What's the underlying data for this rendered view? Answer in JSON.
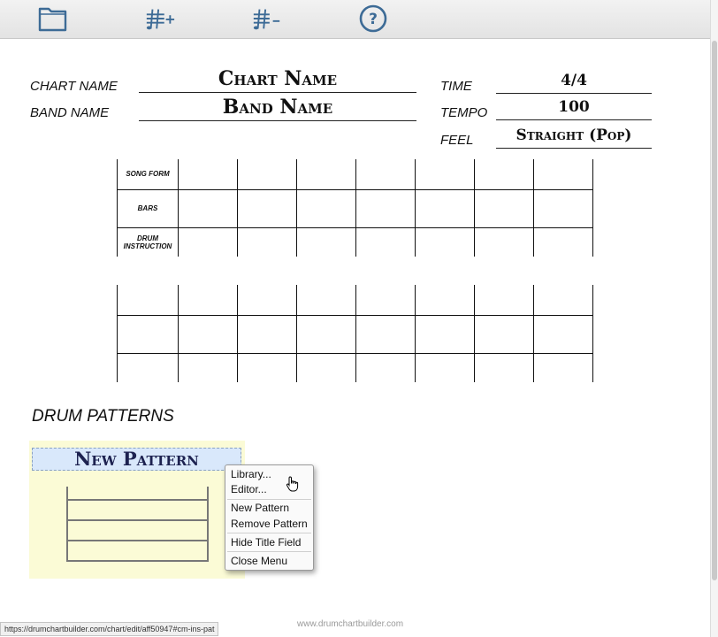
{
  "toolbar": {
    "buttons": [
      {
        "name": "folder-icon"
      },
      {
        "name": "add-row-icon",
        "glyph": "+"
      },
      {
        "name": "remove-row-icon",
        "glyph": "-"
      },
      {
        "name": "help-icon",
        "glyph": "?"
      }
    ]
  },
  "header": {
    "chart_name_label": "CHART NAME",
    "chart_name_value": "Chart Name",
    "band_name_label": "BAND NAME",
    "band_name_value": "Band Name",
    "time_label": "TIME",
    "time_value": "4/4",
    "tempo_label": "TEMPO",
    "tempo_value": "100",
    "feel_label": "FEEL",
    "feel_value": "Straight (Pop)"
  },
  "grid": {
    "row_labels": {
      "song_form": "SONG FORM",
      "bars": "BARS",
      "drum_instruction_1": "DRUM",
      "drum_instruction_2": "INSTRUCTION"
    }
  },
  "patterns": {
    "section_title": "DRUM PATTERNS",
    "pattern_title": "New Pattern"
  },
  "context_menu": {
    "library": "Library...",
    "editor": "Editor...",
    "new_pattern": "New Pattern",
    "remove_pattern": "Remove Pattern",
    "hide_title": "Hide Title Field",
    "close_menu": "Close Menu"
  },
  "status_bar": {
    "url": "https://drumchartbuilder.com/chart/edit/aff50947#cm-ins-pat"
  },
  "footer": {
    "site": "www.drumchartbuilder.com"
  },
  "colors": {
    "icon_blue": "#3d6b96",
    "pattern_bg": "#fbfbd6",
    "pattern_title_bg": "#d9e8fb"
  }
}
